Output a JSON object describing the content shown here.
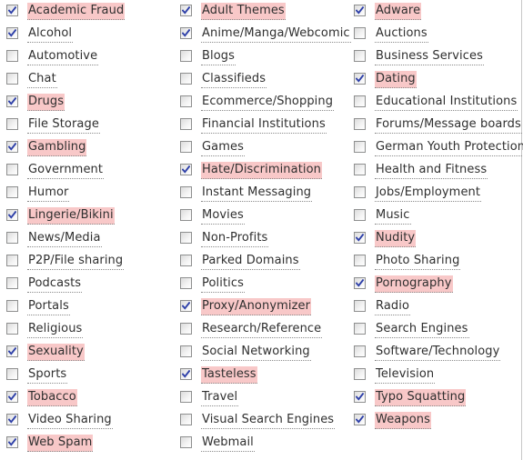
{
  "colors": {
    "highlight": "#f8c8c8",
    "check": "#2d3fa8",
    "text": "#2f2f2f"
  },
  "icons": {
    "checked": "checkmark-icon"
  },
  "categories": [
    [
      {
        "label": "Academic Fraud",
        "checked": true,
        "highlighted": true
      },
      {
        "label": "Adult Themes",
        "checked": true,
        "highlighted": true
      },
      {
        "label": "Adware",
        "checked": true,
        "highlighted": true
      }
    ],
    [
      {
        "label": "Alcohol",
        "checked": true,
        "highlighted": false
      },
      {
        "label": "Anime/Manga/Webcomic",
        "checked": true,
        "highlighted": false
      },
      {
        "label": "Auctions",
        "checked": false,
        "highlighted": false
      }
    ],
    [
      {
        "label": "Automotive",
        "checked": false,
        "highlighted": false
      },
      {
        "label": "Blogs",
        "checked": false,
        "highlighted": false
      },
      {
        "label": "Business Services",
        "checked": false,
        "highlighted": false
      }
    ],
    [
      {
        "label": "Chat",
        "checked": false,
        "highlighted": false
      },
      {
        "label": "Classifieds",
        "checked": false,
        "highlighted": false
      },
      {
        "label": "Dating",
        "checked": true,
        "highlighted": true
      }
    ],
    [
      {
        "label": "Drugs",
        "checked": true,
        "highlighted": true
      },
      {
        "label": "Ecommerce/Shopping",
        "checked": false,
        "highlighted": false
      },
      {
        "label": "Educational Institutions",
        "checked": false,
        "highlighted": false
      }
    ],
    [
      {
        "label": "File Storage",
        "checked": false,
        "highlighted": false
      },
      {
        "label": "Financial Institutions",
        "checked": false,
        "highlighted": false
      },
      {
        "label": "Forums/Message boards",
        "checked": false,
        "highlighted": false
      }
    ],
    [
      {
        "label": "Gambling",
        "checked": true,
        "highlighted": true
      },
      {
        "label": "Games",
        "checked": false,
        "highlighted": false
      },
      {
        "label": "German Youth Protection",
        "checked": false,
        "highlighted": false
      }
    ],
    [
      {
        "label": "Government",
        "checked": false,
        "highlighted": false
      },
      {
        "label": "Hate/Discrimination",
        "checked": true,
        "highlighted": true
      },
      {
        "label": "Health and Fitness",
        "checked": false,
        "highlighted": false
      }
    ],
    [
      {
        "label": "Humor",
        "checked": false,
        "highlighted": false
      },
      {
        "label": "Instant Messaging",
        "checked": false,
        "highlighted": false
      },
      {
        "label": "Jobs/Employment",
        "checked": false,
        "highlighted": false
      }
    ],
    [
      {
        "label": "Lingerie/Bikini",
        "checked": true,
        "highlighted": true
      },
      {
        "label": "Movies",
        "checked": false,
        "highlighted": false
      },
      {
        "label": "Music",
        "checked": false,
        "highlighted": false
      }
    ],
    [
      {
        "label": "News/Media",
        "checked": false,
        "highlighted": false
      },
      {
        "label": "Non-Profits",
        "checked": false,
        "highlighted": false
      },
      {
        "label": "Nudity",
        "checked": true,
        "highlighted": true
      }
    ],
    [
      {
        "label": "P2P/File sharing",
        "checked": false,
        "highlighted": false
      },
      {
        "label": "Parked Domains",
        "checked": false,
        "highlighted": false
      },
      {
        "label": "Photo Sharing",
        "checked": false,
        "highlighted": false
      }
    ],
    [
      {
        "label": "Podcasts",
        "checked": false,
        "highlighted": false
      },
      {
        "label": "Politics",
        "checked": false,
        "highlighted": false
      },
      {
        "label": "Pornography",
        "checked": true,
        "highlighted": true
      }
    ],
    [
      {
        "label": "Portals",
        "checked": false,
        "highlighted": false
      },
      {
        "label": "Proxy/Anonymizer",
        "checked": true,
        "highlighted": true
      },
      {
        "label": "Radio",
        "checked": false,
        "highlighted": false
      }
    ],
    [
      {
        "label": "Religious",
        "checked": false,
        "highlighted": false
      },
      {
        "label": "Research/Reference",
        "checked": false,
        "highlighted": false
      },
      {
        "label": "Search Engines",
        "checked": false,
        "highlighted": false
      }
    ],
    [
      {
        "label": "Sexuality",
        "checked": true,
        "highlighted": true
      },
      {
        "label": "Social Networking",
        "checked": false,
        "highlighted": false
      },
      {
        "label": "Software/Technology",
        "checked": false,
        "highlighted": false
      }
    ],
    [
      {
        "label": "Sports",
        "checked": false,
        "highlighted": false
      },
      {
        "label": "Tasteless",
        "checked": true,
        "highlighted": true
      },
      {
        "label": "Television",
        "checked": false,
        "highlighted": false
      }
    ],
    [
      {
        "label": "Tobacco",
        "checked": true,
        "highlighted": true
      },
      {
        "label": "Travel",
        "checked": false,
        "highlighted": false
      },
      {
        "label": "Typo Squatting",
        "checked": true,
        "highlighted": true
      }
    ],
    [
      {
        "label": "Video Sharing",
        "checked": true,
        "highlighted": false
      },
      {
        "label": "Visual Search Engines",
        "checked": false,
        "highlighted": false
      },
      {
        "label": "Weapons",
        "checked": true,
        "highlighted": true
      }
    ],
    [
      {
        "label": "Web Spam",
        "checked": true,
        "highlighted": true
      },
      {
        "label": "Webmail",
        "checked": false,
        "highlighted": false
      }
    ]
  ]
}
